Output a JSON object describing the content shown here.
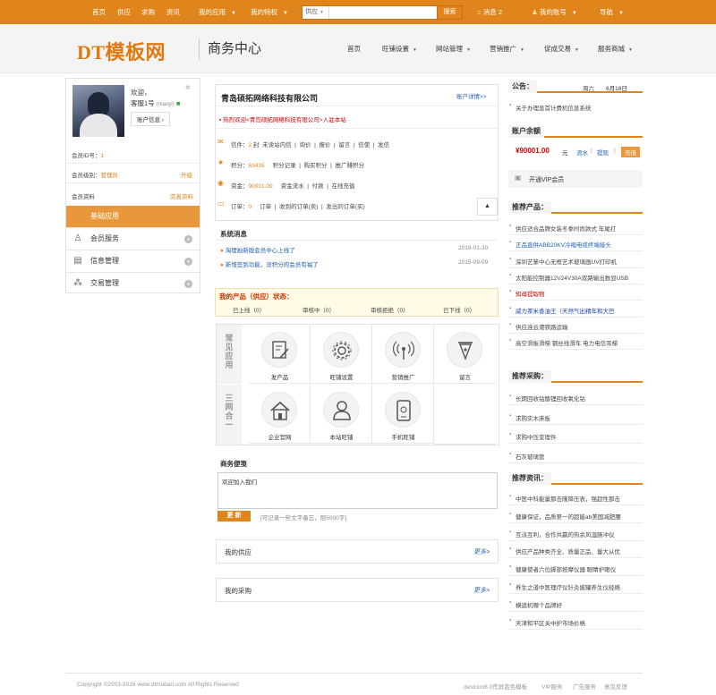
{
  "topbar": {
    "home": "首页",
    "supply": "供应",
    "buy": "求购",
    "news": "资讯",
    "my_apps": "我的应用",
    "my_favs": "我的特权",
    "search_type": "供应",
    "search_placeholder": "",
    "search_button": "搜索",
    "messages": "消息",
    "message_count": "2",
    "my_account": "我的账号",
    "nav": "导航"
  },
  "header": {
    "logo": "DT模板网",
    "subtitle": "商务中心",
    "nav": [
      "首页",
      "旺铺设置",
      "网站管理",
      "营销推广",
      "促成交易",
      "服务商城"
    ]
  },
  "user": {
    "greeting": "欢迎，",
    "name": "客服1号",
    "username": "(maoyi)",
    "account_button": "账户信息",
    "member_id_label": "会员ID号：",
    "member_id": "1",
    "level_label": "会员级别：",
    "level": "管理员",
    "upgrade": "升级",
    "profile_label": "会员资料",
    "profile_link": "完善资料"
  },
  "menu": {
    "basic": "基础应用",
    "member_service": "会员服务",
    "info_manage": "信息管理",
    "trade_manage": "交易管理"
  },
  "company": {
    "name": "青岛硕拓网络科技有限公司",
    "details": "账户详情>>",
    "notice": "热烈欢迎<青岛硕拓网络科技有限公司>入驻本站"
  },
  "stats": {
    "mail_label": "信件：",
    "mail_count": "2",
    "mail_unit": "封",
    "station_mail": "未读站内信",
    "inquiry": "询价",
    "quote": "报价",
    "message": "留言",
    "fax": "信使",
    "send": "发信",
    "points_label": "积分：",
    "points": "63435",
    "points_log": "积分记录",
    "buy_points": "购买积分",
    "promote_points": "推广赚积分",
    "funds_label": "资金：",
    "funds": "90001.00",
    "funds_flow": "资金流水",
    "pay": "付款",
    "recharge": "在线充值",
    "orders_label": "订单：",
    "orders_zero": "0",
    "orders": "订单",
    "received_orders": "收到的订单(卖)",
    "sent_orders": "发出的订单(买)"
  },
  "system": {
    "title": "系统消息",
    "items": [
      {
        "text": "淘理拍新版会员中心上线了",
        "date": "2016-01-30"
      },
      {
        "text": "新增签到功能，没积分的会员有福了",
        "date": "2015-09-09"
      }
    ]
  },
  "products": {
    "title": "我的产品（供应）状态：",
    "online": "已上线（0）",
    "pending": "审核中（0）",
    "rejected": "审核拒绝（0）",
    "offline": "已下线（0）"
  },
  "apps": {
    "common_title": "常见应用",
    "three_title": "三网合一",
    "items": [
      {
        "label": "发产品",
        "icon": "edit-document-icon"
      },
      {
        "label": "旺铺设置",
        "icon": "gear-icon"
      },
      {
        "label": "营销推广",
        "icon": "signal-icon"
      },
      {
        "label": "留言",
        "icon": "pen-nib-icon"
      },
      {
        "label": "企业官网",
        "icon": "house-icon"
      },
      {
        "label": "本站旺铺",
        "icon": "person-icon"
      },
      {
        "label": "手机旺铺",
        "icon": "mobile-icon"
      }
    ]
  },
  "memo": {
    "title": "商务便笺",
    "text": "欢迎加入我们",
    "button": "更 新",
    "hint": "[可记录一些文字备忘，限5000字]"
  },
  "supply_box": {
    "title": "我的供应",
    "more": "更多>"
  },
  "buy_box": {
    "title": "我的采购",
    "more": "更多>"
  },
  "announce": {
    "title": "公告：",
    "weekday": "周六",
    "date": "6月18日",
    "items": [
      "关于办理息首计费机信息系统"
    ]
  },
  "balance": {
    "title": "账户余额",
    "amount": "¥90001.00",
    "unit": "元",
    "flow": "流水",
    "withdraw": "提现",
    "recharge": "充值"
  },
  "vip": {
    "label": "开通VIP会员"
  },
  "recommend": {
    "title": "推荐产品：",
    "items": [
      {
        "text": "供应适合品牌女装冬季时尚款式 年尾打",
        "color": "#444444"
      },
      {
        "text": "正品直供ABB20KV冷缩电缆终端接头",
        "color": "#1e5fb4"
      },
      {
        "text": "深圳艺篆中心无框艺术玻璃画UV打印机",
        "color": "#444444"
      },
      {
        "text": "太阳能控制器12V24V30A双路输出数显USB",
        "color": "#444444"
      },
      {
        "text": "知母提取物",
        "color": "#cc0000"
      },
      {
        "text": "威力茶米香油王（天然气出精年和大巴",
        "color": "#1e3fb4"
      },
      {
        "text": "供应连云港铁路运输",
        "color": "#444444"
      },
      {
        "text": "高空滑板滑梯 钢丝线滑车 电力电信吊梯",
        "color": "#444444"
      }
    ]
  },
  "purchase": {
    "title": "推荐采购：",
    "items": [
      "长期回收钴酸锂回收氧化钴",
      "求购实木床板",
      "求购中压变理件",
      "石灰玻璃管"
    ]
  },
  "news": {
    "title": "推荐资讯：",
    "items": [
      "中医中科能量那击隆降压表，强超性那击",
      "健康保证，品质第一的超能ab美国减肥腰",
      "互派互利，合作共赢的热余风湿肠冲仪",
      "供应产品种类齐全、质量正品、量大从优",
      "健康使者六位脚部按摩仪器 眼睛护眼仪",
      "养生之道中医理疗仪针灸披罐养生仪经络",
      "横遮机哪个品牌好",
      "天津和平区关中护市场价格"
    ]
  },
  "footer": {
    "copyright": "Copyright ©2003-2016 www.dtmuban.com All Rights Reserved",
    "links": [
      "destoon6.0荒屏蓝色模板",
      "VIP服务",
      "广告服务",
      "意见反馈"
    ]
  },
  "colors": {
    "accent": "#e0851c",
    "link": "#1e5fb4"
  }
}
